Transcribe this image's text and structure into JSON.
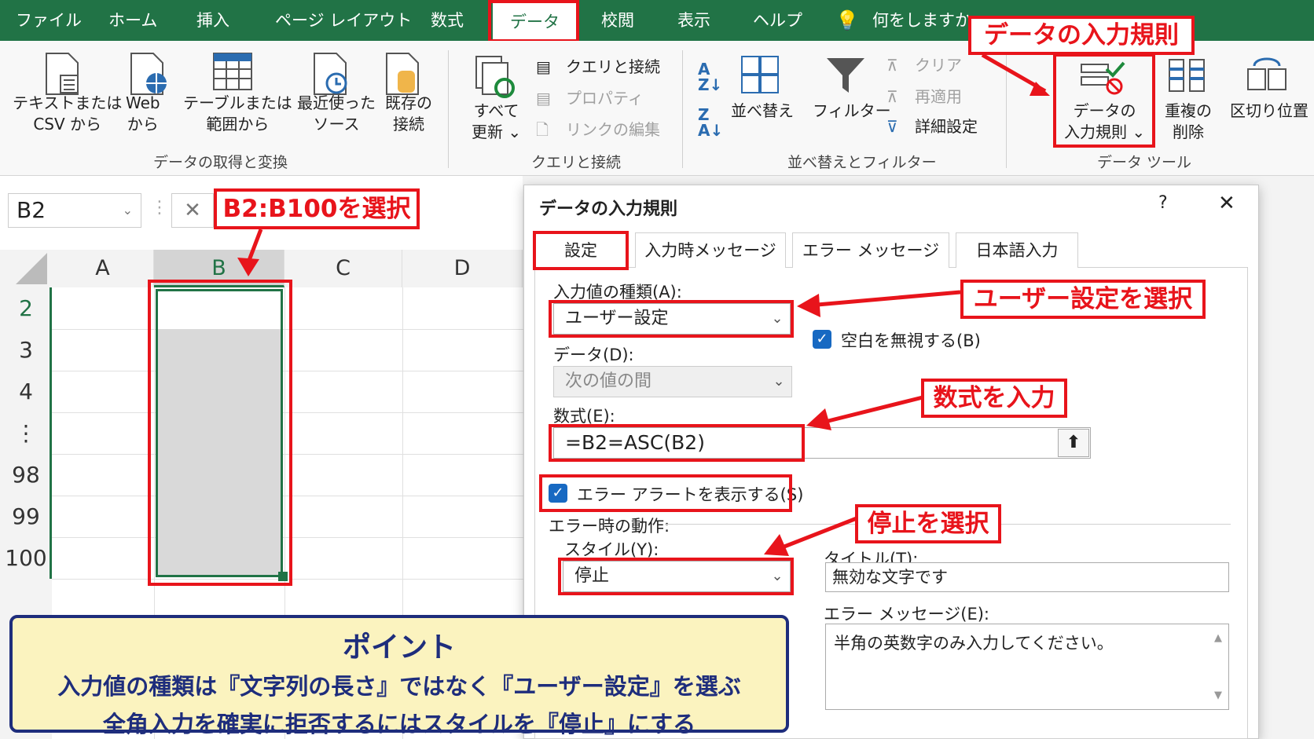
{
  "ribbon_tabs": [
    "ファイル",
    "ホーム",
    "挿入",
    "ページ レイアウト",
    "数式",
    "データ",
    "校閲",
    "表示",
    "ヘルプ",
    "何をしますか"
  ],
  "ribbon": {
    "get_transform": {
      "btn1": [
        "テキストまたは",
        "CSV から"
      ],
      "btn2": [
        "Web",
        "から"
      ],
      "btn3": [
        "テーブルまたは",
        "範囲から"
      ],
      "btn4": [
        "最近使った",
        "ソース"
      ],
      "btn5": [
        "既存の",
        "接続"
      ],
      "label": "データの取得と変換"
    },
    "queries": {
      "refresh": [
        "すべて",
        "更新 ⌄"
      ],
      "items": [
        "クエリと接続",
        "プロパティ",
        "リンクの編集"
      ],
      "label": "クエリと接続"
    },
    "sort_filter": {
      "sort": "並べ替え",
      "filter": "フィルター",
      "items": [
        "クリア",
        "再適用",
        "詳細設定"
      ],
      "label": "並べ替えとフィルター"
    },
    "data_tools": {
      "validation": [
        "データの",
        "入力規則 ⌄"
      ],
      "remove_dup": [
        "重複の",
        "削除"
      ],
      "split": "区切り位置",
      "label": "データ ツール"
    }
  },
  "callouts": {
    "validation": "データの入力規則",
    "range": "B2:B100を選択",
    "custom": "ユーザー設定を選択",
    "formula": "数式を入力",
    "stop": "停止を選択"
  },
  "sheet": {
    "name_box": "B2",
    "columns": [
      "A",
      "B",
      "C",
      "D"
    ],
    "rows": [
      "2",
      "3",
      "4",
      "⋮",
      "98",
      "99",
      "100"
    ]
  },
  "dialog": {
    "title": "データの入力規則",
    "help": "?",
    "close": "✕",
    "tabs": [
      "設定",
      "入力時メッセージ",
      "エラー メッセージ",
      "日本語入力"
    ],
    "allow_label": "入力値の種類(A):",
    "allow_value": "ユーザー設定",
    "ignore_blank": "空白を無視する(B)",
    "data_label": "データ(D):",
    "data_value": "次の値の間",
    "formula_label": "数式(E):",
    "formula_value": "=B2=ASC(B2)",
    "show_alert": "エラー アラートを表示する(S)",
    "error_action": "エラー時の動作:",
    "style_label": "スタイル(Y):",
    "style_value": "停止",
    "title_label": "タイトル(T):",
    "title_value": "無効な文字です",
    "msg_label": "エラー メッセージ(E):",
    "msg_value": "半角の英数字のみ入力してください。"
  },
  "point": {
    "heading": "ポイント",
    "line1": "入力値の種類は『文字列の長さ』ではなく『ユーザー設定』を選ぶ",
    "line2": "全角入力を確実に拒否するにはスタイルを『停止』にする"
  }
}
